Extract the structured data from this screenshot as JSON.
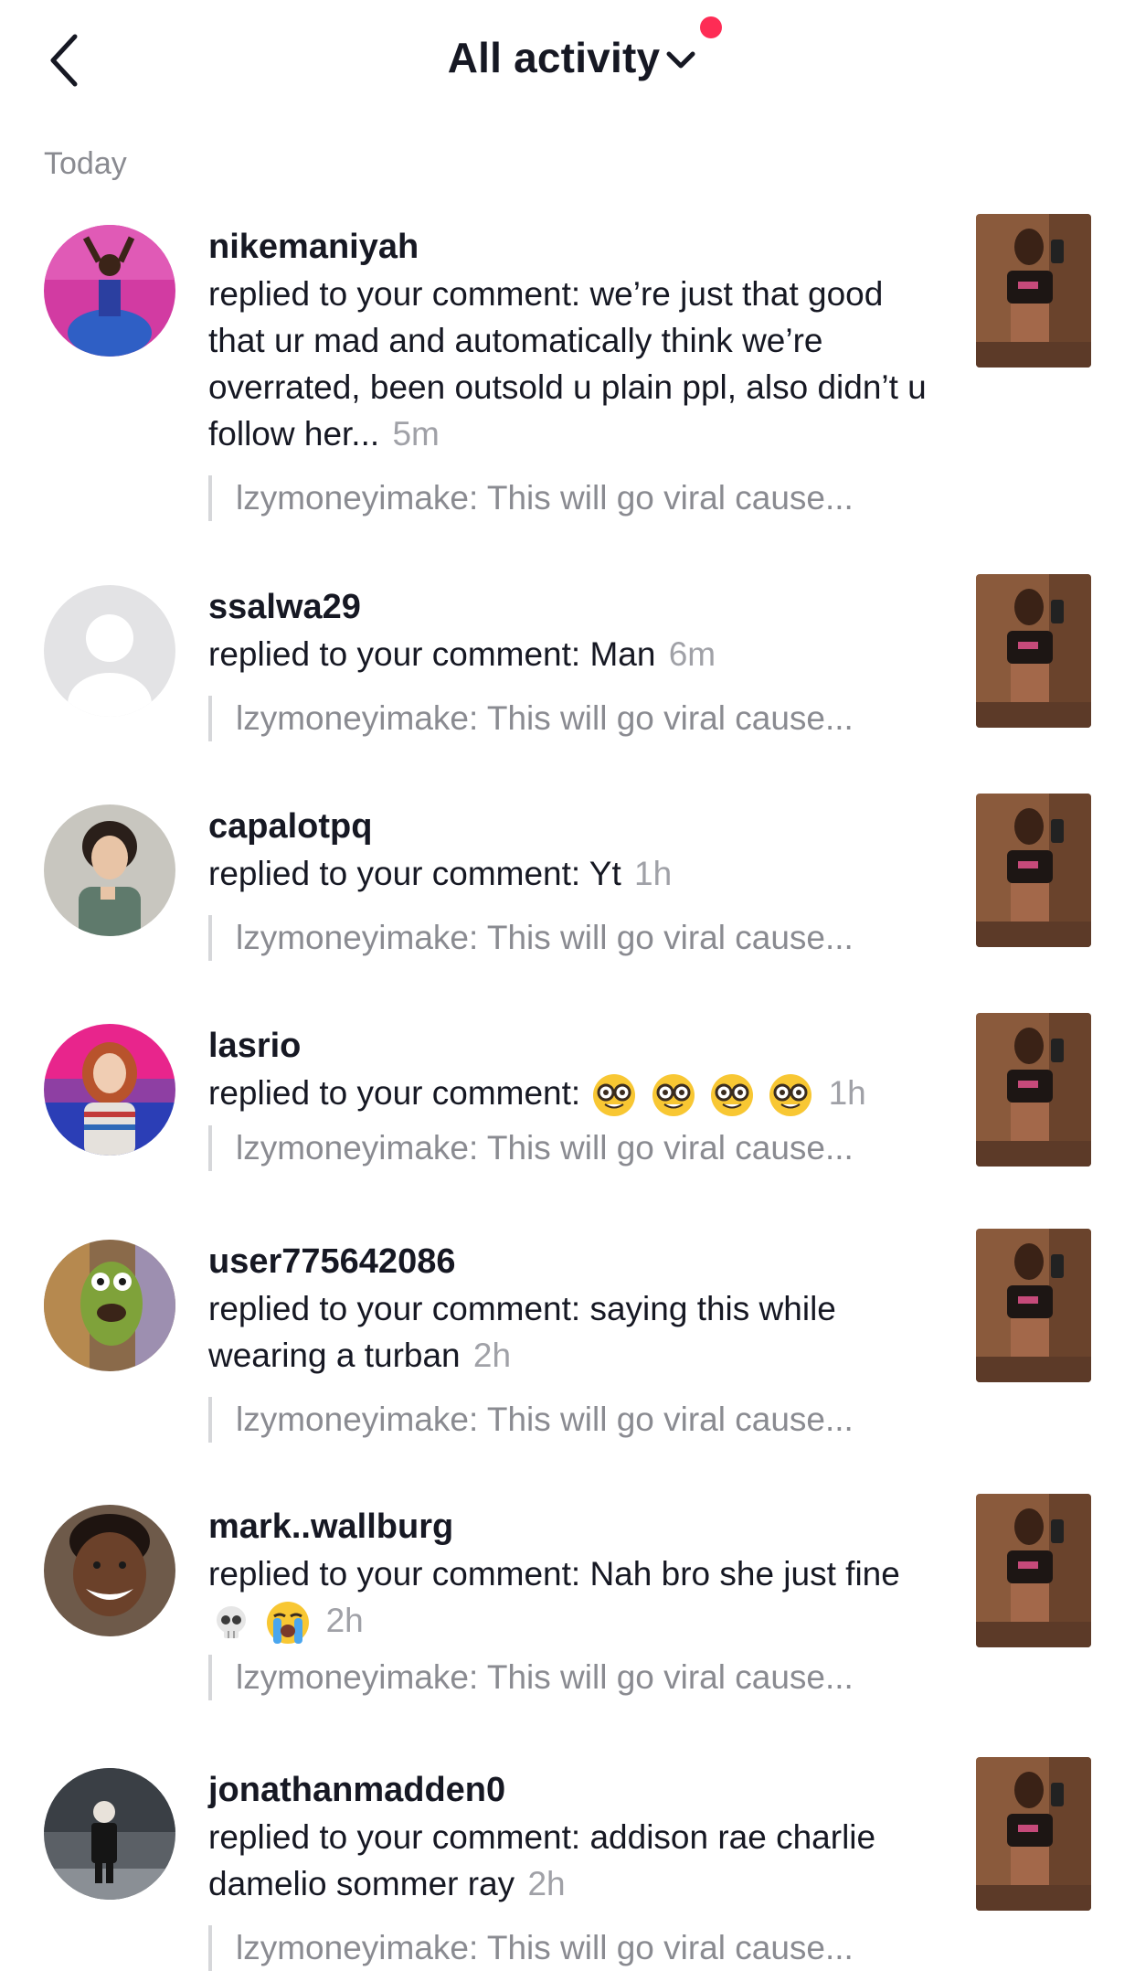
{
  "header": {
    "title": "All activity"
  },
  "section": {
    "label": "Today"
  },
  "items": [
    {
      "username": "nikemaniyah",
      "message": "replied to your comment: we’re just that good that ur mad and automatically think we’re overrated, been outsold u plain ppl, also didn’t u follow her...",
      "time": "5m",
      "quote": "lzymoneyimake: This will go viral cause..."
    },
    {
      "username": "ssalwa29",
      "message": "replied to your comment: Man",
      "time": "6m",
      "quote": "lzymoneyimake: This will go viral cause..."
    },
    {
      "username": "capalotpq",
      "message": "replied to your comment: Yt",
      "time": "1h",
      "quote": "lzymoneyimake: This will go viral cause..."
    },
    {
      "username": "lasrio",
      "message": "replied to your comment:",
      "emojis": [
        "nerd-face-emoji",
        "nerd-face-emoji",
        "nerd-face-emoji",
        "nerd-face-emoji"
      ],
      "time": "1h",
      "quote": "lzymoneyimake: This will go viral cause..."
    },
    {
      "username": "user775642086",
      "message": "replied to your comment: saying this while wearing a turban",
      "time": "2h",
      "quote": "lzymoneyimake: This will go viral cause..."
    },
    {
      "username": "mark..wallburg",
      "message": "replied to your comment: Nah bro she just fine",
      "emojis": [
        "skull-emoji",
        "loudly-crying-emoji"
      ],
      "time": "2h",
      "quote": "lzymoneyimake: This will go viral cause..."
    },
    {
      "username": "jonathanmadden0",
      "message": "replied to your comment: addison rae charlie damelio sommer ray",
      "time": "2h",
      "quote": "lzymoneyimake: This will go viral cause..."
    }
  ],
  "colors": {
    "accent_dot": "#fe2c55",
    "text_primary": "#161823",
    "text_secondary": "#8a8b91"
  },
  "icons": {
    "back": "chevron-left-icon",
    "title_dropdown": "chevron-down-icon"
  }
}
